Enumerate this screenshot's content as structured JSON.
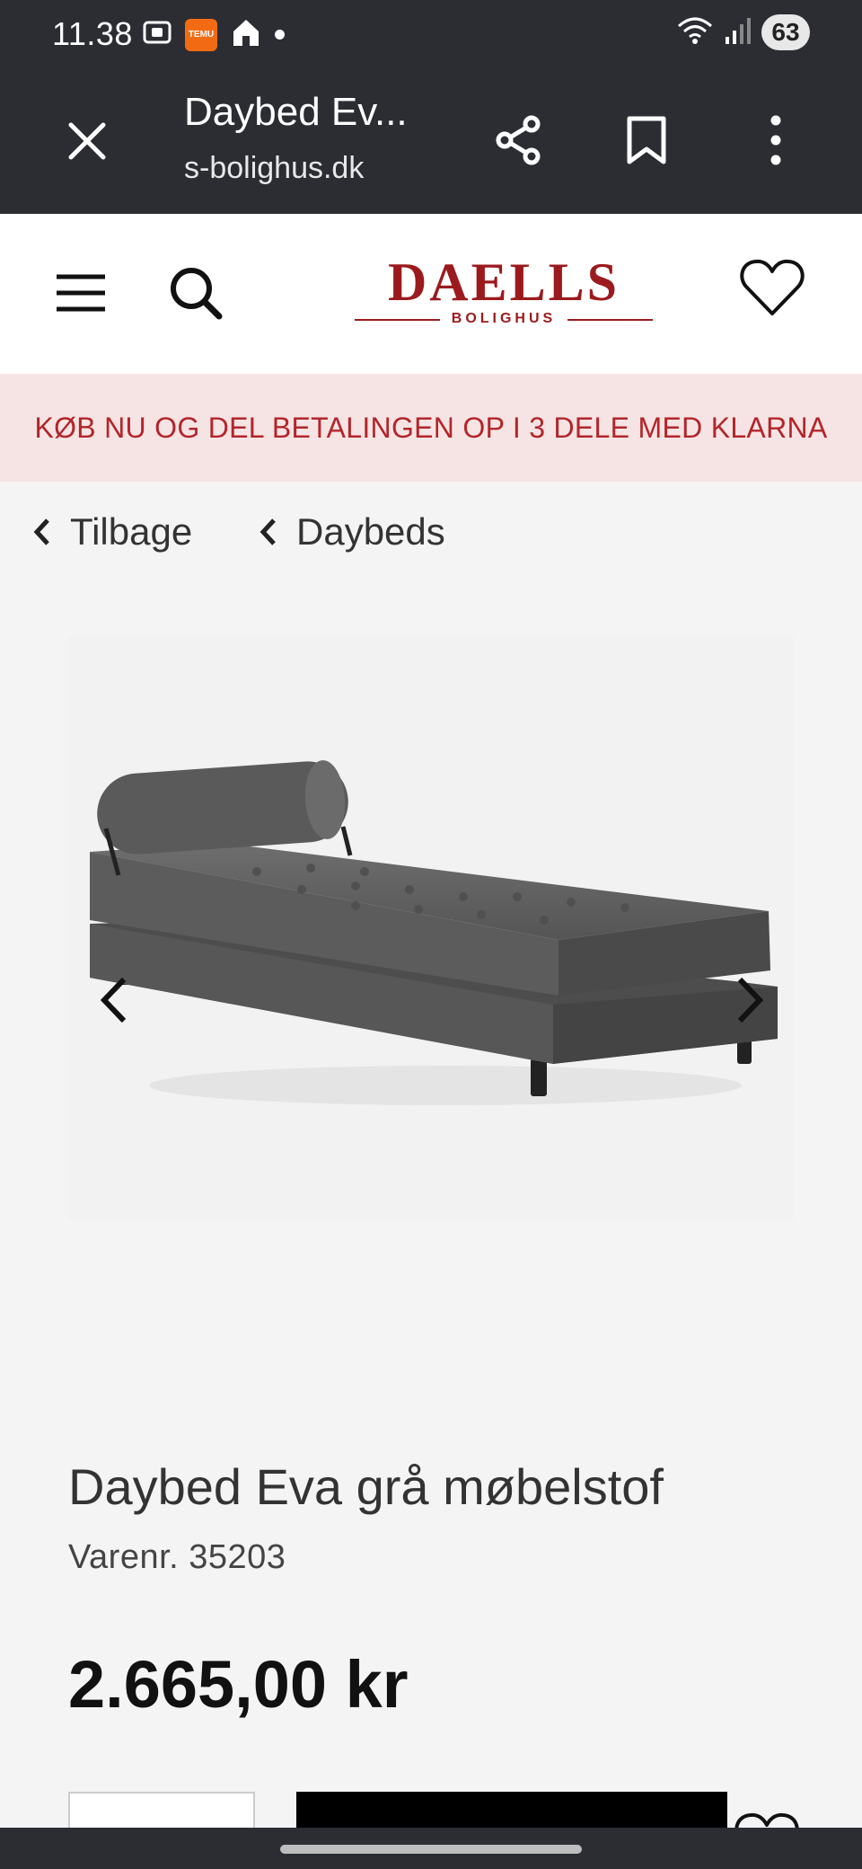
{
  "status_bar": {
    "time": "11.38",
    "temu_badge": "TEMU",
    "battery": "63",
    "icons": [
      "screenshot-icon",
      "temu-icon",
      "home-icon",
      "notification-dot",
      "wifi-icon",
      "signal-icon",
      "battery-icon"
    ]
  },
  "toolbar": {
    "title": "Daybed Ev...",
    "url": "s-bolighus.dk",
    "icons": [
      "close-icon",
      "share-icon",
      "bookmark-icon",
      "more-vert-icon"
    ]
  },
  "header": {
    "logo_main": "DAELLS",
    "logo_sub": "BOLIGHUS",
    "brand_color": "#9b1a1d",
    "icons": [
      "menu-icon",
      "search-icon",
      "heart-icon"
    ]
  },
  "promo": {
    "text": "KØB NU OG DEL BETALINGEN OP I 3 DELE MED KLARNA",
    "background": "#f6e4e4",
    "color": "#b3252a"
  },
  "breadcrumbs": {
    "back_label": "Tilbage",
    "category_label": "Daybeds"
  },
  "gallery": {
    "icons": [
      "chevron-left-icon",
      "chevron-right-icon"
    ]
  },
  "product": {
    "title": "Daybed Eva grå møbelstof",
    "sku": "Varenr. 35203",
    "price": "2.665,00 kr"
  }
}
